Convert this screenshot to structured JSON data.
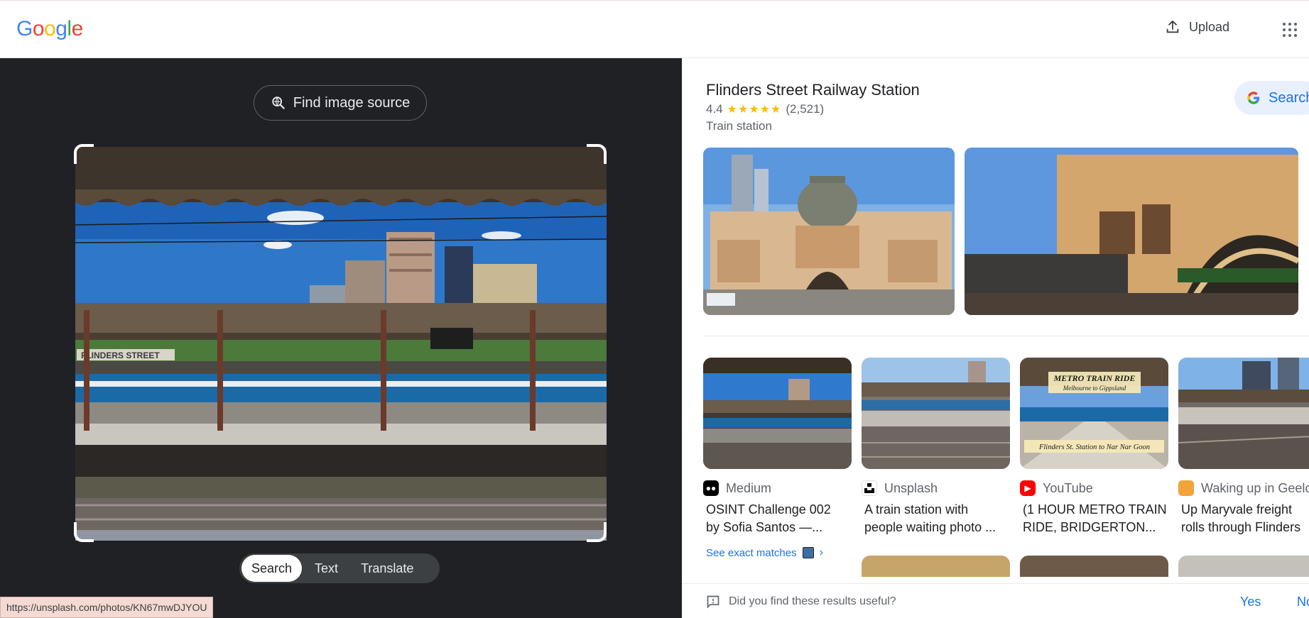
{
  "header": {
    "logo": [
      "G",
      "o",
      "o",
      "g",
      "l",
      "e"
    ],
    "logo_colors": [
      "#4285F4",
      "#EA4335",
      "#FBBC05",
      "#4285F4",
      "#34A853",
      "#EA4335"
    ],
    "upload_label": "Upload",
    "apps_icon": "apps-grid-icon"
  },
  "lens": {
    "find_source_label": "Find image source",
    "modes": [
      {
        "label": "Search",
        "active": true
      },
      {
        "label": "Text",
        "active": false
      },
      {
        "label": "Translate",
        "active": false
      }
    ],
    "photo_sign": "FLINDERS STREET"
  },
  "status_url": "https://unsplash.com/photos/KN67mwDJYOU",
  "place": {
    "title": "Flinders Street Railway Station",
    "rating": "4.4",
    "stars": "★★★★★",
    "reviews": "(2,521)",
    "type": "Train station",
    "search_chip_label": "Search"
  },
  "results": [
    {
      "source": "Medium",
      "title": "OSINT Challenge 002\nby Sofia Santos —...",
      "icon_color": "#000000",
      "icon": "medium-icon"
    },
    {
      "source": "Unsplash",
      "title": "A train station with\npeople waiting photo ...",
      "icon_color": "#000000",
      "icon": "unsplash-icon"
    },
    {
      "source": "YouTube",
      "title": "(1 HOUR METRO TRAIN\nRIDE, BRIDGERTON...",
      "icon_color": "#FF0000",
      "icon": "youtube-icon",
      "overlay_top": "METRO TRAIN RIDE",
      "overlay_sub": "Melbourne to Gippsland",
      "overlay_bottom": "Flinders St. Station to Nar Nar Goon"
    },
    {
      "source": "Waking up in Geelo",
      "title": "Up Maryvale freight\nrolls through Flinders",
      "icon_color": "#f2a33a",
      "icon": "site-icon"
    }
  ],
  "see_exact_matches": "See exact matches",
  "feedback": {
    "question": "Did you find these results useful?",
    "yes": "Yes",
    "no": "No"
  }
}
